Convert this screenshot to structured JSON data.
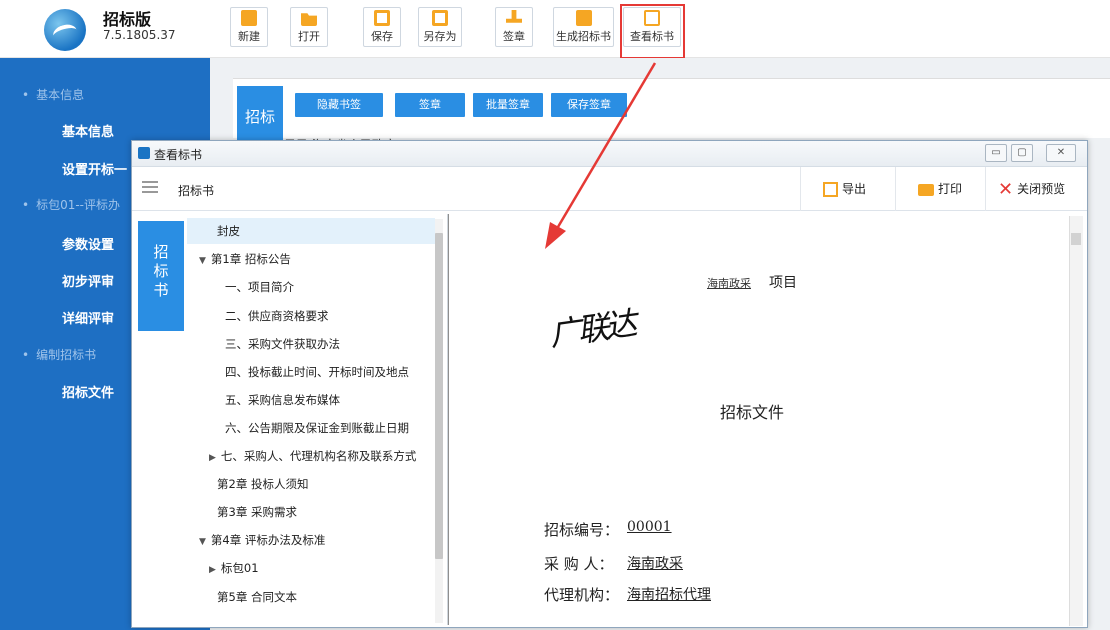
{
  "app": {
    "name": "招标版",
    "version": "7.5.1805.37"
  },
  "toolbar": [
    {
      "label": "新建",
      "icon": "new-file-icon",
      "color": "#f5a623"
    },
    {
      "label": "打开",
      "icon": "folder-open-icon",
      "color": "#f5a623"
    },
    {
      "label": "保存",
      "icon": "save-icon",
      "color": "#f5a623"
    },
    {
      "label": "另存为",
      "icon": "save-as-icon",
      "color": "#f5a623"
    },
    {
      "label": "签章",
      "icon": "stamp-icon",
      "color": "#f5a623"
    },
    {
      "label": "生成招标书",
      "icon": "generate-doc-icon",
      "color": "#f5a623"
    },
    {
      "label": "查看标书",
      "icon": "view-doc-icon",
      "color": "#f5a623"
    }
  ],
  "sidebar": {
    "sections": [
      "基本信息",
      "标包01--评标办",
      "编制招标书"
    ],
    "items": [
      "基本信息",
      "设置开标一",
      "参数设置",
      "初步评审",
      "详细评审",
      "招标文件"
    ]
  },
  "background": {
    "tab": "招标",
    "buttons": [
      "隐藏书签",
      "签章",
      "批量签章",
      "保存签章"
    ],
    "dir_text": "目录  海南省人民政府"
  },
  "dialog": {
    "title": "查看标书",
    "label": "招标书",
    "actions": [
      "导出",
      "打印",
      "关闭预览"
    ],
    "vertical_tab": [
      "招",
      "标",
      "书"
    ],
    "toc": [
      {
        "text": "封皮"
      },
      {
        "text": "第1章 招标公告",
        "tri": "▼"
      },
      {
        "text": "一、项目简介"
      },
      {
        "text": "二、供应商资格要求"
      },
      {
        "text": "三、采购文件获取办法"
      },
      {
        "text": "四、投标截止时间、开标时间及地点"
      },
      {
        "text": "五、采购信息发布媒体"
      },
      {
        "text": "六、公告期限及保证金到账截止日期"
      },
      {
        "text": "七、采购人、代理机构名称及联系方式",
        "tri": "▶"
      },
      {
        "text": "第2章 投标人须知"
      },
      {
        "text": "第3章 采购需求"
      },
      {
        "text": "第4章 评标办法及标准",
        "tri": "▼"
      },
      {
        "text": "标包01",
        "tri": "▶"
      },
      {
        "text": "第5章 合同文本"
      }
    ],
    "document": {
      "project_prefix": "海南政采",
      "project_suffix": "项目",
      "signature": "广联达",
      "title": "招标文件",
      "fields": [
        {
          "label": "招标编号：",
          "value": "00001"
        },
        {
          "label": "采 购 人：",
          "value": "海南政采"
        },
        {
          "label": "代理机构：",
          "value": "海南招标代理"
        }
      ]
    }
  },
  "colors": {
    "sidebar": "#1e6fc3",
    "accent": "#2a8ee3",
    "highlight": "#e53935"
  }
}
